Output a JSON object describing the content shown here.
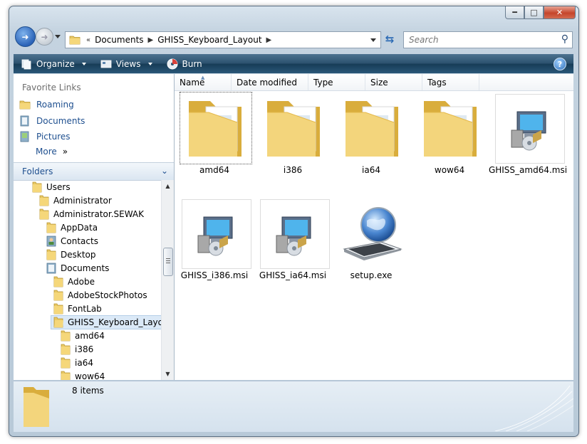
{
  "window": {
    "caption_buttons": [
      "minimize-icon",
      "maximize-icon",
      "close-icon"
    ]
  },
  "address_bar": {
    "prefix": "«",
    "breadcrumbs": [
      "Documents",
      "GHISS_Keyboard_Layout"
    ]
  },
  "search": {
    "placeholder": "Search"
  },
  "toolbar": {
    "organize_label": "Organize",
    "views_label": "Views",
    "burn_label": "Burn"
  },
  "favorite_links": {
    "title": "Favorite Links",
    "items": [
      {
        "label": "Roaming",
        "icon": "folder-icon"
      },
      {
        "label": "Documents",
        "icon": "documents-icon"
      },
      {
        "label": "Pictures",
        "icon": "pictures-icon"
      },
      {
        "label": "More",
        "icon": "double-chevron-right-icon"
      }
    ]
  },
  "folders_pane": {
    "title": "Folders",
    "tree": [
      {
        "label": "Users",
        "depth": 0
      },
      {
        "label": "Administrator",
        "depth": 1
      },
      {
        "label": "Administrator.SEWAK",
        "depth": 1
      },
      {
        "label": "AppData",
        "depth": 2
      },
      {
        "label": "Contacts",
        "depth": 2
      },
      {
        "label": "Desktop",
        "depth": 2
      },
      {
        "label": "Documents",
        "depth": 2
      },
      {
        "label": "Adobe",
        "depth": 3
      },
      {
        "label": "AdobeStockPhotos",
        "depth": 3
      },
      {
        "label": "FontLab",
        "depth": 3
      },
      {
        "label": "GHISS_Keyboard_Layout",
        "depth": 3,
        "selected": true
      },
      {
        "label": "amd64",
        "depth": 4
      },
      {
        "label": "i386",
        "depth": 4
      },
      {
        "label": "ia64",
        "depth": 4
      },
      {
        "label": "wow64",
        "depth": 4
      }
    ]
  },
  "columns": [
    "Name",
    "Date modified",
    "Type",
    "Size",
    "Tags"
  ],
  "files": [
    {
      "name": "amd64",
      "kind": "folder",
      "focused": true
    },
    {
      "name": "i386",
      "kind": "folder"
    },
    {
      "name": "ia64",
      "kind": "folder"
    },
    {
      "name": "wow64",
      "kind": "folder"
    },
    {
      "name": "GHISS_amd64.msi",
      "kind": "msi"
    },
    {
      "name": "GHISS_i386.msi",
      "kind": "msi"
    },
    {
      "name": "GHISS_ia64.msi",
      "kind": "msi"
    },
    {
      "name": "setup.exe",
      "kind": "setup"
    }
  ],
  "details_pane": {
    "item_count": "8 items"
  },
  "colors": {
    "command_bar": "#2c526f",
    "link": "#1e4f8f",
    "selection": "#dbe9f7"
  }
}
